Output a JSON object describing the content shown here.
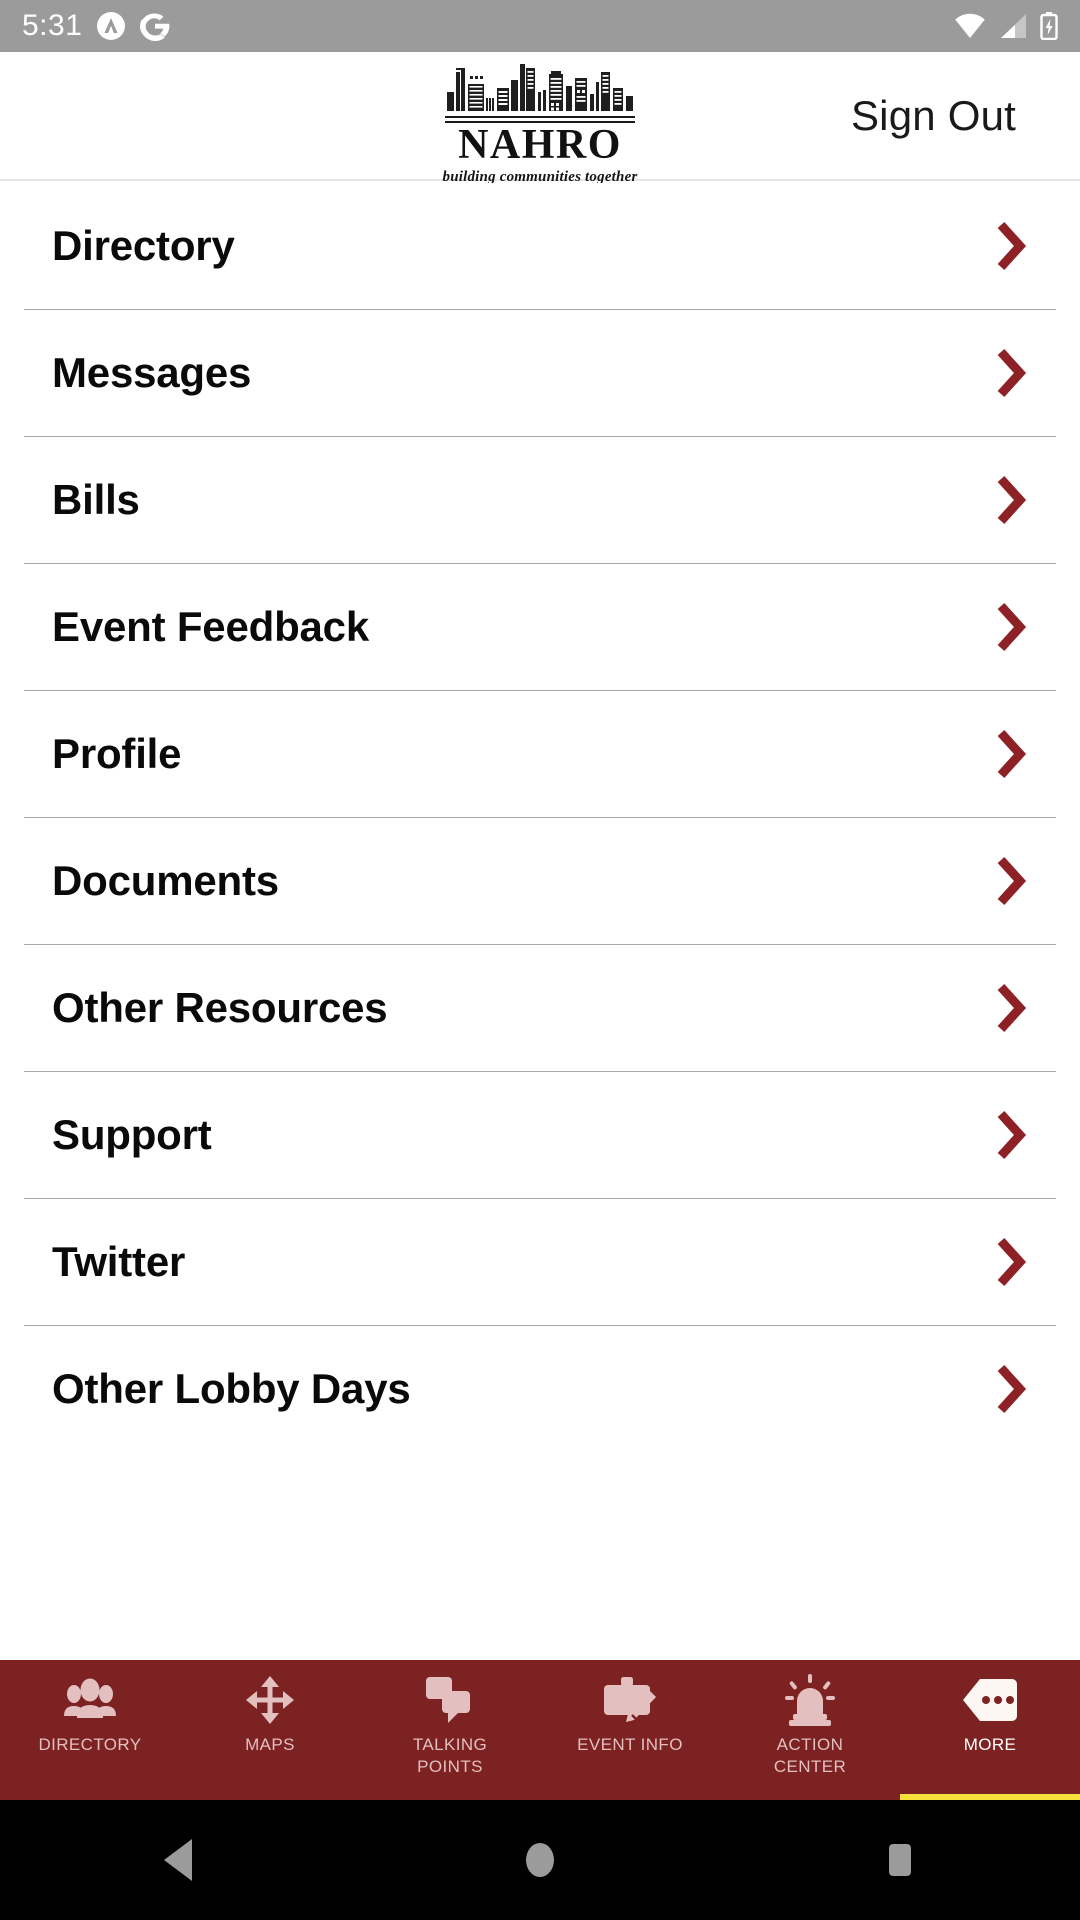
{
  "status_bar": {
    "time": "5:31",
    "left_icons": [
      "adobe-icon",
      "google-icon"
    ],
    "right_icons": [
      "wifi-icon",
      "cellular-signal-icon",
      "battery-charging-icon"
    ],
    "background_color": "#9b9b9b"
  },
  "header": {
    "logo": {
      "wordmark": "NAHRO",
      "tagline": "building communities together",
      "graphic": "city-skyline"
    },
    "sign_out_label": "Sign Out"
  },
  "menu": {
    "items": [
      {
        "label": "Directory"
      },
      {
        "label": "Messages"
      },
      {
        "label": "Bills"
      },
      {
        "label": "Event Feedback"
      },
      {
        "label": "Profile"
      },
      {
        "label": "Documents"
      },
      {
        "label": "Other Resources"
      },
      {
        "label": "Support"
      },
      {
        "label": "Twitter"
      },
      {
        "label": "Other Lobby Days"
      }
    ],
    "chevron_color": "#8e2125"
  },
  "tabbar": {
    "background_color": "#7c2223",
    "active_color": "#ffffff",
    "inactive_color": "#e3bfbf",
    "underline_color": "#f7e03c",
    "tabs": [
      {
        "label": "Directory",
        "icon": "people-group-icon",
        "active": false
      },
      {
        "label": "Maps",
        "icon": "move-arrows-icon",
        "active": false
      },
      {
        "label": "Talking\nPoints",
        "line1": "TALKING",
        "line2": "POINTS",
        "icon": "chat-bubbles-icon",
        "active": false
      },
      {
        "label": "Event Info",
        "icon": "briefcase-pencil-icon",
        "active": false
      },
      {
        "label": "Action\nCenter",
        "line1": "ACTION",
        "line2": "CENTER",
        "icon": "siren-icon",
        "active": false
      },
      {
        "label": "More",
        "icon": "ellipsis-tag-icon",
        "active": true
      }
    ]
  },
  "android_nav": {
    "buttons": [
      "back-button",
      "home-button",
      "recents-button"
    ],
    "background_color": "#000000",
    "icon_color": "#9b9b9b"
  }
}
